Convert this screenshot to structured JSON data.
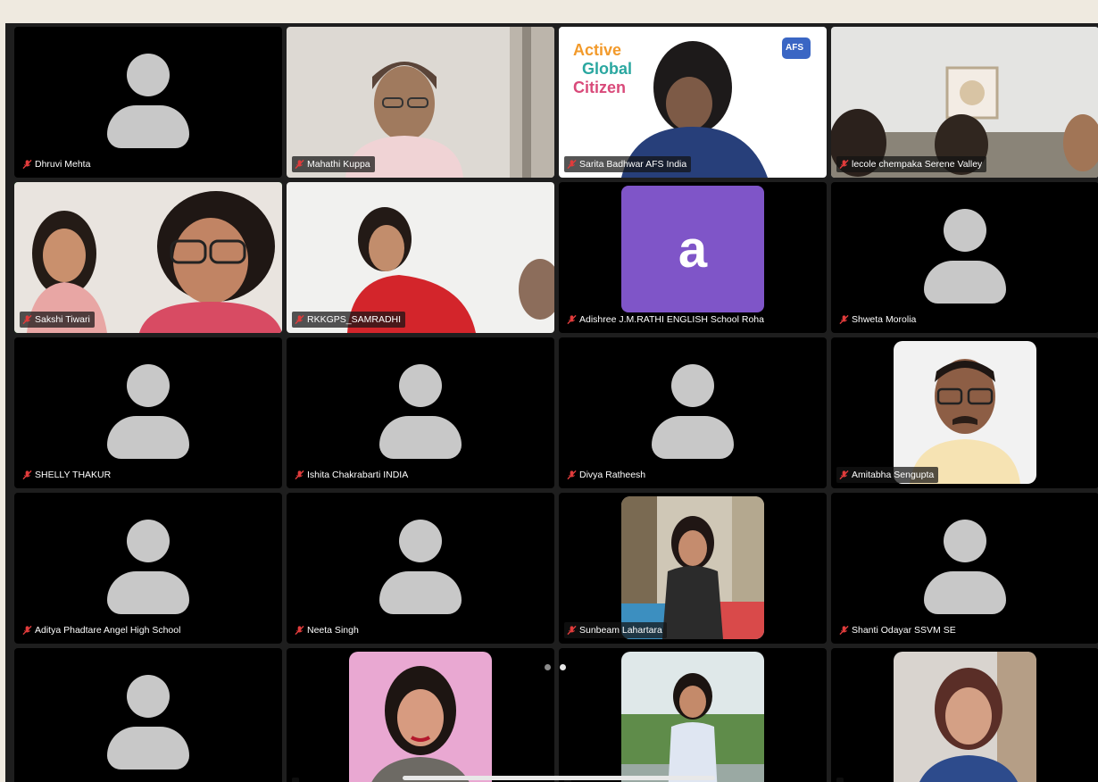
{
  "participants": [
    {
      "name": "Dhruvi Mehta"
    },
    {
      "name": "Mahathi Kuppa"
    },
    {
      "name": "Sarita Badhwar AFS India",
      "banner": [
        "Active",
        "Global",
        "Citizen"
      ],
      "logo": "AFS"
    },
    {
      "name": "lecole chempaka Serene Valley"
    },
    {
      "name": "Sakshi Tiwari"
    },
    {
      "name": "RKKGPS_SAMRADHI"
    },
    {
      "name": "Adishree  J.M.RATHI ENGLISH School Roha",
      "avatar_letter": "a"
    },
    {
      "name": "Shweta Morolia"
    },
    {
      "name": "SHELLY THAKUR"
    },
    {
      "name": "Ishita Chakrabarti INDIA"
    },
    {
      "name": "Divya Ratheesh"
    },
    {
      "name": "Amitabha Sengupta"
    },
    {
      "name": "Aditya Phadtare Angel High School"
    },
    {
      "name": "Neeta Singh"
    },
    {
      "name": "Sunbeam Lahartara"
    },
    {
      "name": "Shanti Odayar SSVM SE"
    },
    {
      "name": ""
    },
    {
      "name": ""
    },
    {
      "name": ""
    },
    {
      "name": ""
    }
  ],
  "active_speaker_index": 4,
  "pagination": {
    "pages": 2,
    "current": 2
  },
  "colors": {
    "active_border": "#27c93f",
    "avatar_purple": "#7f55c8",
    "muted_mic": "#e03b3b"
  }
}
